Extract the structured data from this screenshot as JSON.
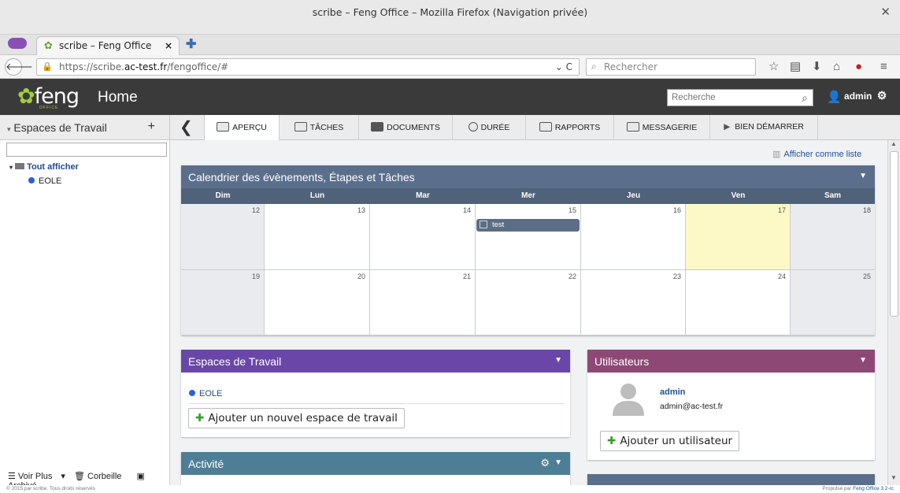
{
  "browser": {
    "window_title": "scribe – Feng Office – Mozilla Firefox (Navigation privée)",
    "tab_title": "scribe – Feng Office",
    "url_prefix": "https://scribe.",
    "url_domain": "ac-test.fr",
    "url_path": "/fengoffice/#",
    "search_placeholder": "Rechercher"
  },
  "app": {
    "logo_text": "feng",
    "logo_sub": "OFFICE",
    "page_title": "Home",
    "search_placeholder": "Recherche",
    "user_name": "admin"
  },
  "toolbar": {
    "workspaces_label": "Espaces de Travail",
    "tabs": [
      {
        "label": "APERÇU"
      },
      {
        "label": "TÂCHES"
      },
      {
        "label": "DOCUMENTS"
      },
      {
        "label": "DURÉE"
      },
      {
        "label": "RAPPORTS"
      },
      {
        "label": "MESSAGERIE"
      },
      {
        "label": "BIEN DÉMARRER"
      }
    ]
  },
  "sidebar": {
    "root": "Tout afficher",
    "items": [
      {
        "label": "EOLE"
      }
    ],
    "footer": {
      "more": "Voir Plus",
      "trash": "Corbeille",
      "archive": "Archivé"
    }
  },
  "main": {
    "list_link": "Afficher comme liste",
    "calendar": {
      "title": "Calendrier des évènements, Étapes et Tâches",
      "days": [
        "Dim",
        "Lun",
        "Mar",
        "Mer",
        "Jeu",
        "Ven",
        "Sam"
      ],
      "week1": [
        "12",
        "13",
        "14",
        "15",
        "16",
        "17",
        "18"
      ],
      "week2": [
        "19",
        "20",
        "21",
        "22",
        "23",
        "24",
        "25"
      ],
      "event": "test"
    },
    "workspaces_panel": {
      "title": "Espaces de Travail",
      "item": "EOLE",
      "add_button": "Ajouter un nouvel espace de travail"
    },
    "users_panel": {
      "title": "Utilisateurs",
      "user_name": "admin",
      "user_email": "admin@ac-test.fr",
      "add_button": "Ajouter un utilisateur"
    },
    "activity_panel": {
      "title": "Activité"
    }
  },
  "footer": {
    "left": "© 2015 par scribe. Tous droits réservés",
    "right_prefix": "Propulsé par",
    "right_link": "Feng Office 3.2-rc"
  },
  "colors": {
    "calendar_header": "#5b6f8c",
    "workspaces_header": "#6a46a8",
    "users_header": "#8e4876",
    "activity_header": "#4e7e96",
    "today_cell": "#fdf9c6"
  }
}
